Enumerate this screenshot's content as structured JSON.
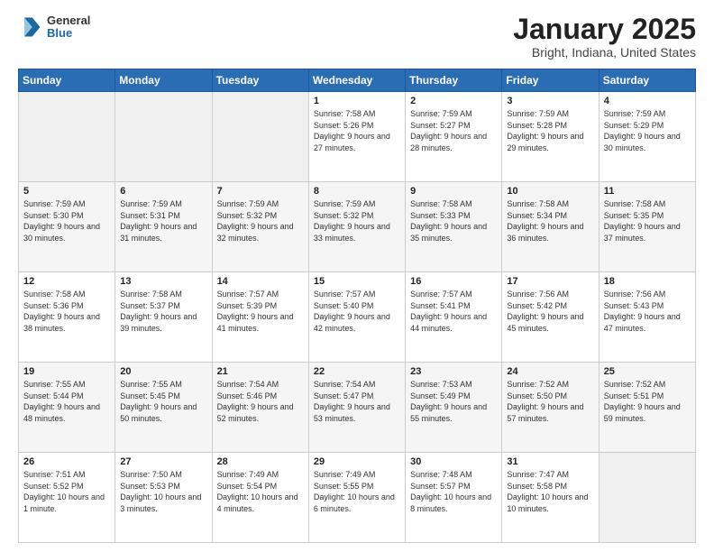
{
  "header": {
    "logo_line1": "General",
    "logo_line2": "Blue",
    "month": "January 2025",
    "location": "Bright, Indiana, United States"
  },
  "weekdays": [
    "Sunday",
    "Monday",
    "Tuesday",
    "Wednesday",
    "Thursday",
    "Friday",
    "Saturday"
  ],
  "weeks": [
    [
      {
        "day": "",
        "empty": true
      },
      {
        "day": "",
        "empty": true
      },
      {
        "day": "",
        "empty": true
      },
      {
        "day": "1",
        "rise": "7:58 AM",
        "set": "5:26 PM",
        "daylight": "9 hours and 27 minutes."
      },
      {
        "day": "2",
        "rise": "7:59 AM",
        "set": "5:27 PM",
        "daylight": "9 hours and 28 minutes."
      },
      {
        "day": "3",
        "rise": "7:59 AM",
        "set": "5:28 PM",
        "daylight": "9 hours and 29 minutes."
      },
      {
        "day": "4",
        "rise": "7:59 AM",
        "set": "5:29 PM",
        "daylight": "9 hours and 30 minutes."
      }
    ],
    [
      {
        "day": "5",
        "rise": "7:59 AM",
        "set": "5:30 PM",
        "daylight": "9 hours and 30 minutes."
      },
      {
        "day": "6",
        "rise": "7:59 AM",
        "set": "5:31 PM",
        "daylight": "9 hours and 31 minutes."
      },
      {
        "day": "7",
        "rise": "7:59 AM",
        "set": "5:32 PM",
        "daylight": "9 hours and 32 minutes."
      },
      {
        "day": "8",
        "rise": "7:59 AM",
        "set": "5:32 PM",
        "daylight": "9 hours and 33 minutes."
      },
      {
        "day": "9",
        "rise": "7:58 AM",
        "set": "5:33 PM",
        "daylight": "9 hours and 35 minutes."
      },
      {
        "day": "10",
        "rise": "7:58 AM",
        "set": "5:34 PM",
        "daylight": "9 hours and 36 minutes."
      },
      {
        "day": "11",
        "rise": "7:58 AM",
        "set": "5:35 PM",
        "daylight": "9 hours and 37 minutes."
      }
    ],
    [
      {
        "day": "12",
        "rise": "7:58 AM",
        "set": "5:36 PM",
        "daylight": "9 hours and 38 minutes."
      },
      {
        "day": "13",
        "rise": "7:58 AM",
        "set": "5:37 PM",
        "daylight": "9 hours and 39 minutes."
      },
      {
        "day": "14",
        "rise": "7:57 AM",
        "set": "5:39 PM",
        "daylight": "9 hours and 41 minutes."
      },
      {
        "day": "15",
        "rise": "7:57 AM",
        "set": "5:40 PM",
        "daylight": "9 hours and 42 minutes."
      },
      {
        "day": "16",
        "rise": "7:57 AM",
        "set": "5:41 PM",
        "daylight": "9 hours and 44 minutes."
      },
      {
        "day": "17",
        "rise": "7:56 AM",
        "set": "5:42 PM",
        "daylight": "9 hours and 45 minutes."
      },
      {
        "day": "18",
        "rise": "7:56 AM",
        "set": "5:43 PM",
        "daylight": "9 hours and 47 minutes."
      }
    ],
    [
      {
        "day": "19",
        "rise": "7:55 AM",
        "set": "5:44 PM",
        "daylight": "9 hours and 48 minutes."
      },
      {
        "day": "20",
        "rise": "7:55 AM",
        "set": "5:45 PM",
        "daylight": "9 hours and 50 minutes."
      },
      {
        "day": "21",
        "rise": "7:54 AM",
        "set": "5:46 PM",
        "daylight": "9 hours and 52 minutes."
      },
      {
        "day": "22",
        "rise": "7:54 AM",
        "set": "5:47 PM",
        "daylight": "9 hours and 53 minutes."
      },
      {
        "day": "23",
        "rise": "7:53 AM",
        "set": "5:49 PM",
        "daylight": "9 hours and 55 minutes."
      },
      {
        "day": "24",
        "rise": "7:52 AM",
        "set": "5:50 PM",
        "daylight": "9 hours and 57 minutes."
      },
      {
        "day": "25",
        "rise": "7:52 AM",
        "set": "5:51 PM",
        "daylight": "9 hours and 59 minutes."
      }
    ],
    [
      {
        "day": "26",
        "rise": "7:51 AM",
        "set": "5:52 PM",
        "daylight": "10 hours and 1 minute."
      },
      {
        "day": "27",
        "rise": "7:50 AM",
        "set": "5:53 PM",
        "daylight": "10 hours and 3 minutes."
      },
      {
        "day": "28",
        "rise": "7:49 AM",
        "set": "5:54 PM",
        "daylight": "10 hours and 4 minutes."
      },
      {
        "day": "29",
        "rise": "7:49 AM",
        "set": "5:55 PM",
        "daylight": "10 hours and 6 minutes."
      },
      {
        "day": "30",
        "rise": "7:48 AM",
        "set": "5:57 PM",
        "daylight": "10 hours and 8 minutes."
      },
      {
        "day": "31",
        "rise": "7:47 AM",
        "set": "5:58 PM",
        "daylight": "10 hours and 10 minutes."
      },
      {
        "day": "",
        "empty": true
      }
    ]
  ]
}
